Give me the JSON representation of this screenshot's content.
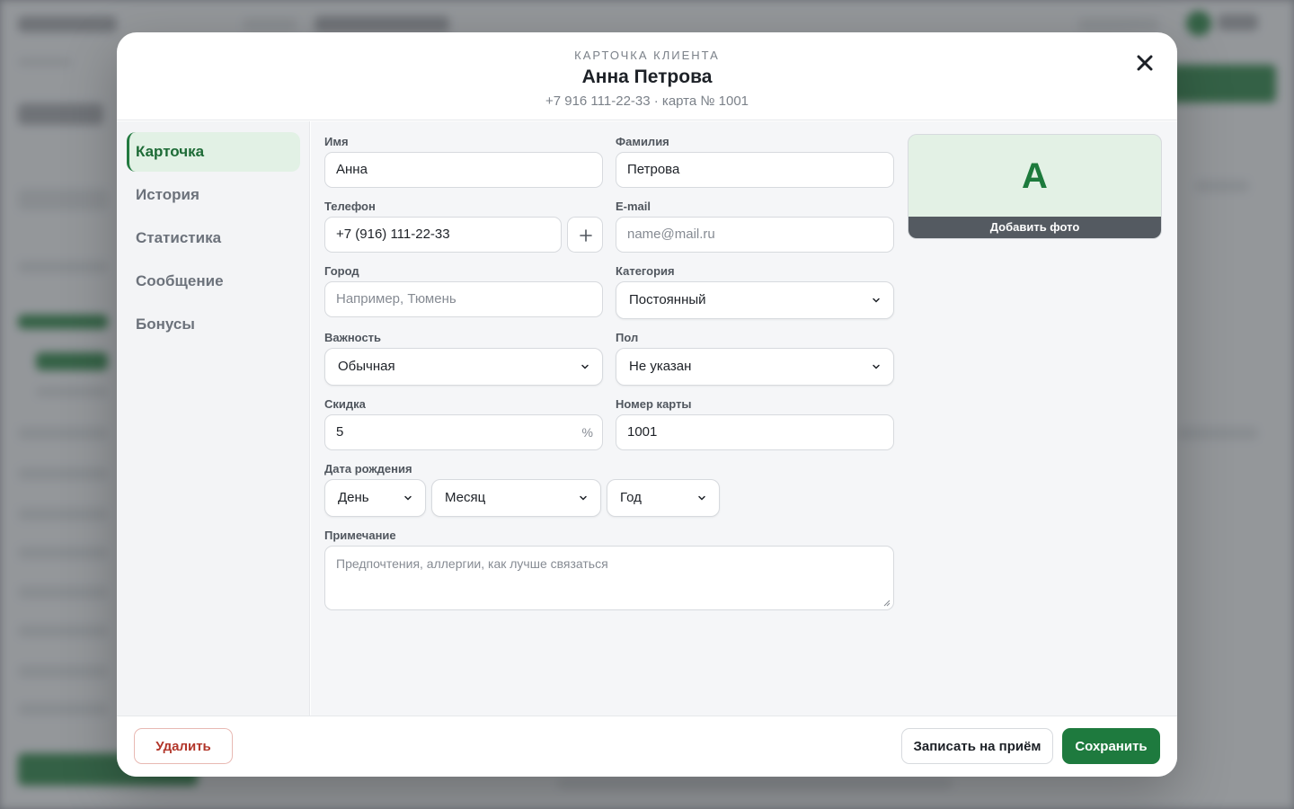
{
  "header": {
    "eyebrow": "КАРТОЧКА КЛИЕНТА",
    "client_name": "Анна Петрова",
    "client_meta": "+7 916 111-22-33 · карта № 1001"
  },
  "sidebar": {
    "items": [
      {
        "label": "Карточка",
        "active": true
      },
      {
        "label": "История",
        "active": false
      },
      {
        "label": "Статистика",
        "active": false
      },
      {
        "label": "Сообщение",
        "active": false
      },
      {
        "label": "Бонусы",
        "active": false
      }
    ]
  },
  "form": {
    "first_name": {
      "label": "Имя",
      "value": "Анна"
    },
    "last_name": {
      "label": "Фамилия",
      "value": "Петрова"
    },
    "phone": {
      "label": "Телефон",
      "value": "+7 (916) 111-22-33",
      "add_label": "+"
    },
    "email": {
      "label": "E-mail",
      "placeholder": "name@mail.ru"
    },
    "city": {
      "label": "Город",
      "placeholder": "Например, Тюмень"
    },
    "category": {
      "label": "Категория",
      "value": "Постоянный"
    },
    "importance": {
      "label": "Важность",
      "value": "Обычная"
    },
    "gender": {
      "label": "Пол",
      "value": "Не указан"
    },
    "discount": {
      "label": "Скидка",
      "value": "5",
      "suffix": "%"
    },
    "card_number": {
      "label": "Номер карты",
      "value": "1001"
    },
    "birth_date": {
      "label": "Дата рождения",
      "day": "День",
      "month": "Месяц",
      "year": "Год"
    },
    "note": {
      "label": "Примечание",
      "placeholder": "Предпочтения, аллергии, как лучше связаться"
    }
  },
  "photo": {
    "initial": "А",
    "add_label": "Добавить фото"
  },
  "footer": {
    "delete_label": "Удалить",
    "book_label": "Записать на приём",
    "save_label": "Сохранить"
  },
  "colors": {
    "accent": "#1e7a3e",
    "danger": "#b2362a",
    "avatar_bg": "#e3f1e5"
  },
  "icons": {
    "close": "close-icon",
    "chevron": "chevron-down-icon",
    "add": "plus-icon"
  }
}
